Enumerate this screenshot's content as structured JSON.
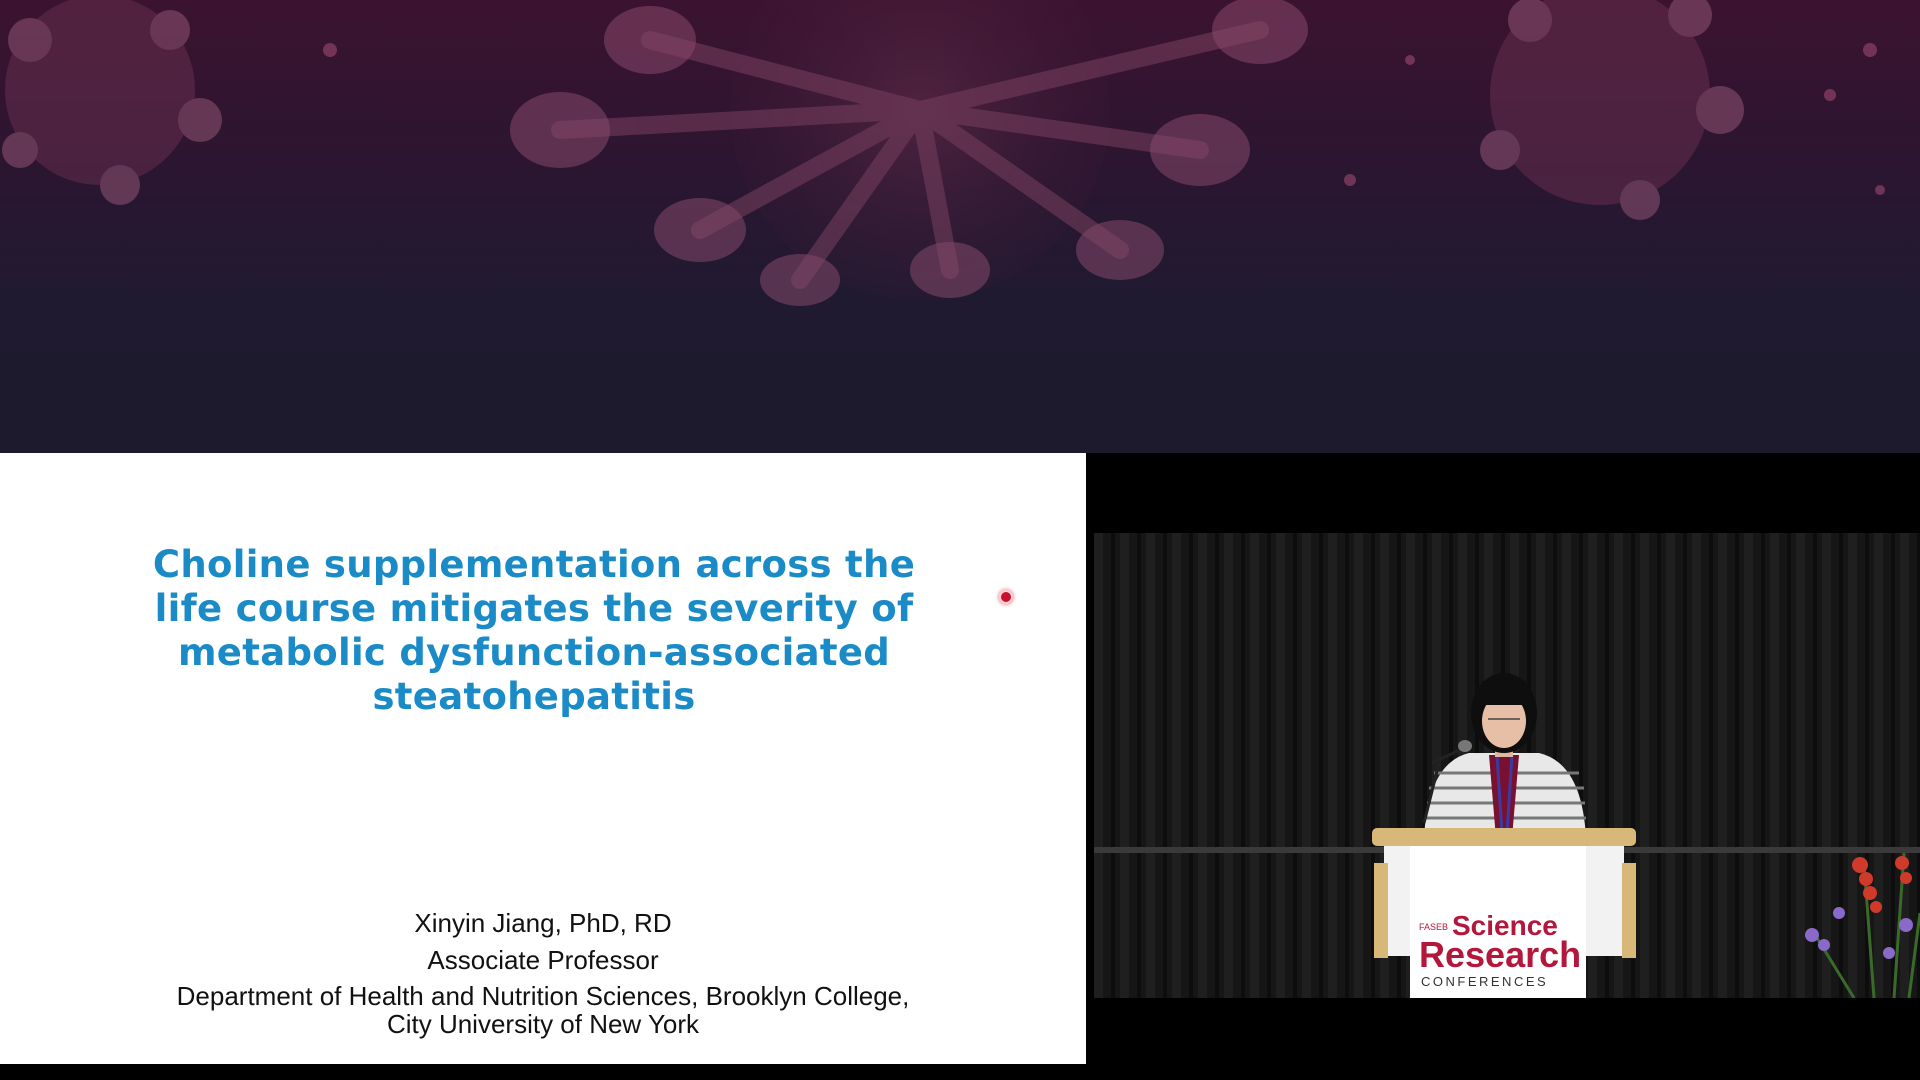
{
  "slide": {
    "title_lines": [
      "Choline supplementation across the",
      "life course mitigates the severity of",
      "metabolic dysfunction-associated",
      "steatohepatitis"
    ],
    "title_color": "#1a8bc6",
    "speaker_name": "Xinyin Jiang, PhD, RD",
    "speaker_role": "Associate Professor",
    "affiliation_line1": "Department of Health and Nutrition Sciences, Brooklyn College,",
    "affiliation_line2": "City University of New York"
  },
  "podium_sign": {
    "org": "FASEB",
    "line1": "Science",
    "line2": "Research",
    "line3": "CONFERENCES",
    "brand_color": "#b3173b"
  },
  "icons": {
    "laser_pointer": "laser-pointer-dot"
  }
}
